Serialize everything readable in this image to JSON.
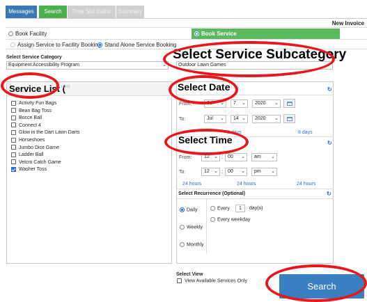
{
  "tabs": {
    "messages": "Messages",
    "search": "Search",
    "timeslot": "Time Slot Editor",
    "summary": "Summary"
  },
  "header": {
    "new_invoice": "New Invoice"
  },
  "booking_type": {
    "book_facility": "Book Facility",
    "book_service": "Book Service",
    "assign_to_facility": "Assign Service to Facility Booking",
    "stand_alone": "Stand Alone Service Booking"
  },
  "category": {
    "label": "Select Service Category",
    "value": "Equipment Accessibility Program"
  },
  "subcategory": {
    "heading": "Select Service Subcategory",
    "value": "Outdoor Lawn Games"
  },
  "service_list": {
    "title": "Service List (",
    "subtitle": "ices)",
    "items": [
      {
        "label": "Activity Fun Bags",
        "checked": false
      },
      {
        "label": "Bean Bag Toss",
        "checked": false
      },
      {
        "label": "Bocce Ball",
        "checked": false
      },
      {
        "label": "Connect 4",
        "checked": false
      },
      {
        "label": "Glow in the Dart Lawn Darts",
        "checked": false
      },
      {
        "label": "Horseshoes",
        "checked": false
      },
      {
        "label": "Jumbo Dice Game",
        "checked": false
      },
      {
        "label": "Ladder Ball",
        "checked": false
      },
      {
        "label": "Velcro Catch Game",
        "checked": false
      },
      {
        "label": "Washer Toss",
        "checked": true
      }
    ]
  },
  "date": {
    "title": "Select Date",
    "from_label": "From:",
    "to_label": "To:",
    "from_month": "Jul",
    "from_day": "7",
    "from_year": "2020",
    "to_month": "Jul",
    "to_day": "14",
    "to_year": "2020",
    "duration_1": "8 days",
    "duration_2": "8 days"
  },
  "time": {
    "title": "Select Time",
    "from_label": "From:",
    "to_label": "To:",
    "from_hour": "12",
    "from_minute": "00",
    "from_ampm": "am",
    "to_hour": "12",
    "to_minute": "00",
    "to_ampm": "pm",
    "hours_1": "24 hours",
    "hours_2": "24 hours",
    "hours_3": "24 hours"
  },
  "recurrence": {
    "title": "Select Recurrence (Optional)",
    "daily": "Daily",
    "weekly": "Weekly",
    "monthly": "Monthly",
    "every_label": "Every",
    "every_value": "1",
    "days_label": "day(s)",
    "every_weekday": "Every weekday"
  },
  "view": {
    "label": "Select View",
    "available_only": "View Available Services Only"
  },
  "search_button": "Search",
  "colors": {
    "accent_green": "#5cb85c",
    "accent_blue": "#3a7fc2",
    "annotation_red": "#e8171c"
  }
}
